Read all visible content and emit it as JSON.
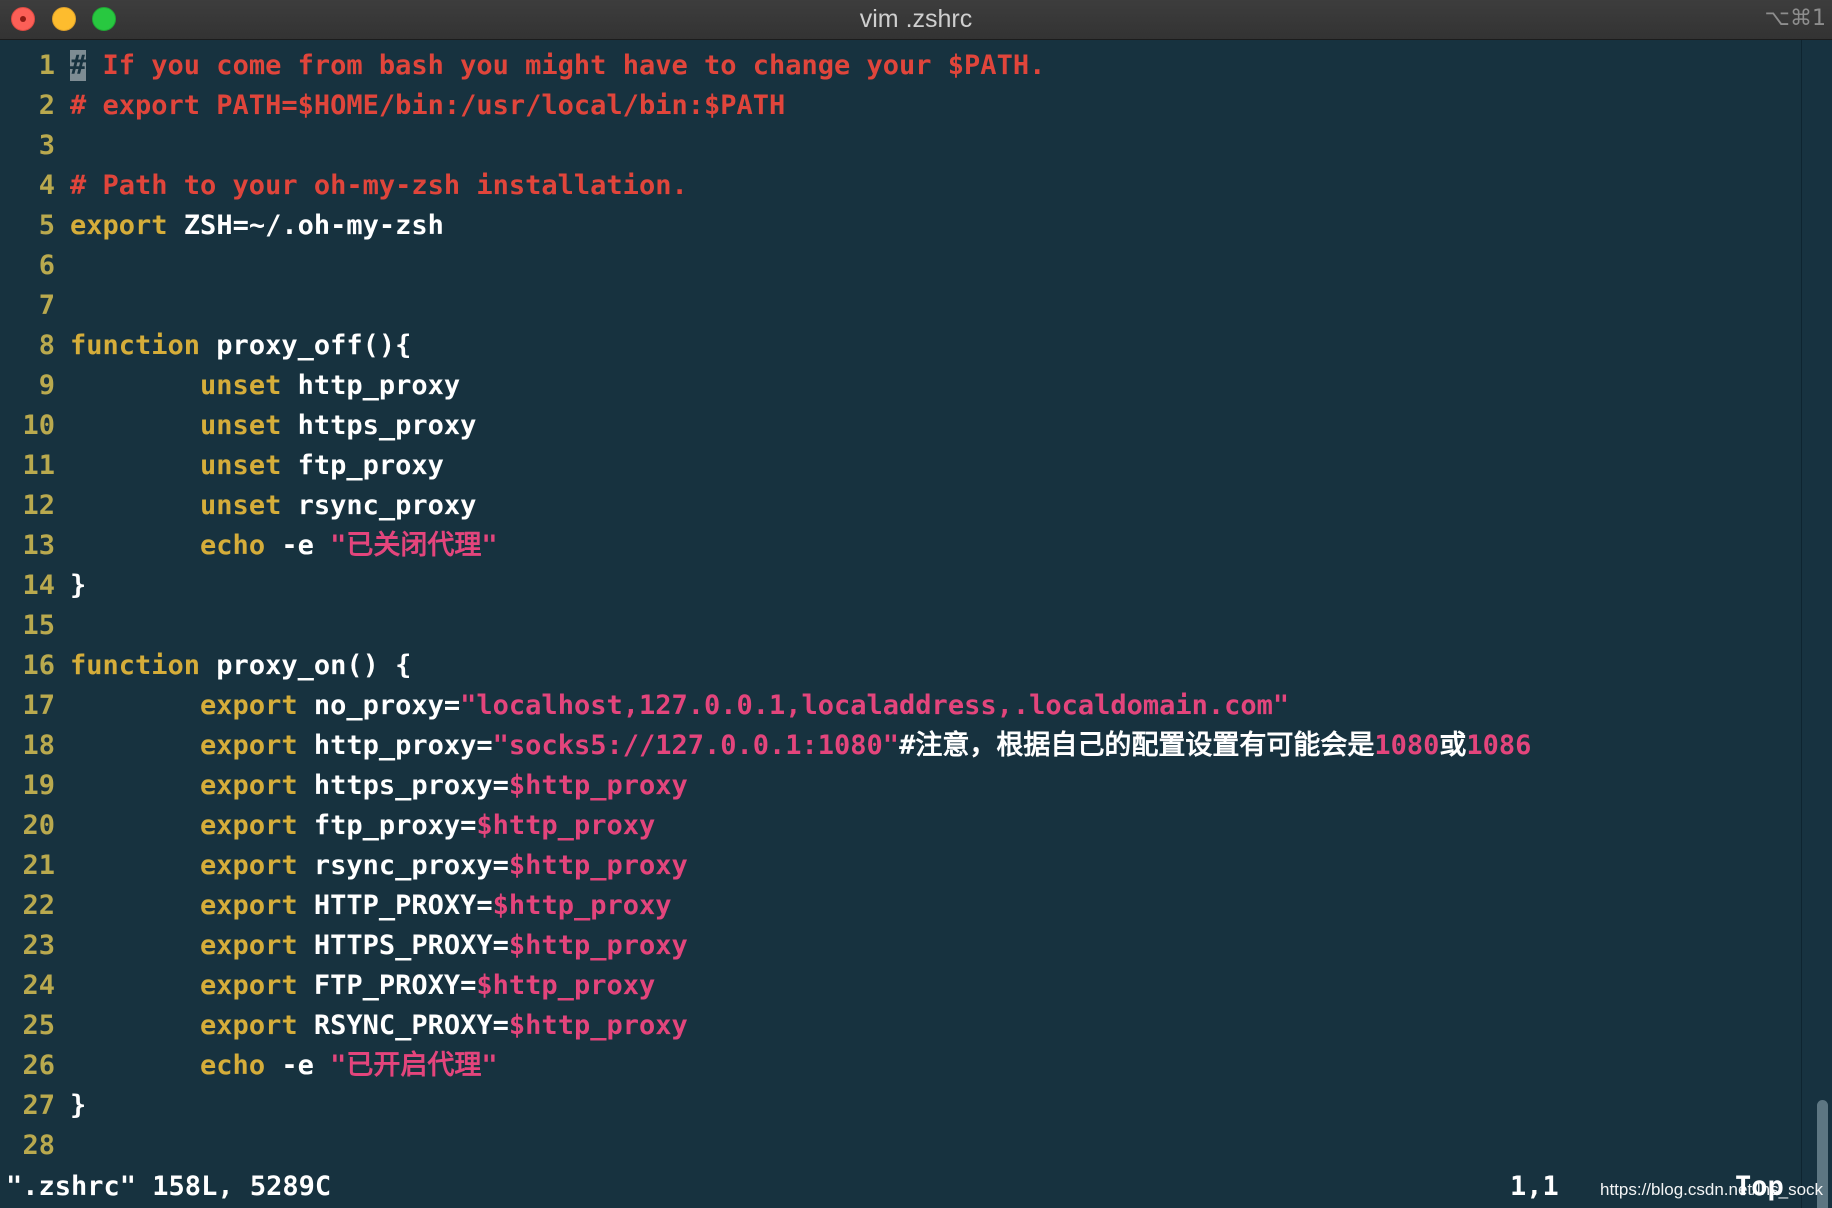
{
  "window": {
    "title": "vim .zshrc",
    "shortcut": "⌥⌘1"
  },
  "editor": {
    "lines": [
      {
        "n": "1",
        "tokens": [
          {
            "t": "#",
            "c": "cursor"
          },
          {
            "t": " If you come from bash you might have to change your $PATH.",
            "c": "cm"
          }
        ]
      },
      {
        "n": "2",
        "tokens": [
          {
            "t": "# export PATH=$HOME/bin:/usr/local/bin:$PATH",
            "c": "cm"
          }
        ]
      },
      {
        "n": "3",
        "tokens": []
      },
      {
        "n": "4",
        "tokens": [
          {
            "t": "# Path to your oh-my-zsh installation.",
            "c": "cm"
          }
        ]
      },
      {
        "n": "5",
        "tokens": [
          {
            "t": "export",
            "c": "kw"
          },
          {
            "t": " ZSH=~/.oh-my-zsh",
            "c": "id"
          }
        ]
      },
      {
        "n": "6",
        "tokens": []
      },
      {
        "n": "7",
        "tokens": []
      },
      {
        "n": "8",
        "tokens": [
          {
            "t": "function",
            "c": "kw"
          },
          {
            "t": " proxy_off(){",
            "c": "id"
          }
        ]
      },
      {
        "n": "9",
        "tokens": [
          {
            "t": "        ",
            "c": "id"
          },
          {
            "t": "unset",
            "c": "kw"
          },
          {
            "t": " http_proxy",
            "c": "id"
          }
        ]
      },
      {
        "n": "10",
        "tokens": [
          {
            "t": "        ",
            "c": "id"
          },
          {
            "t": "unset",
            "c": "kw"
          },
          {
            "t": " https_proxy",
            "c": "id"
          }
        ]
      },
      {
        "n": "11",
        "tokens": [
          {
            "t": "        ",
            "c": "id"
          },
          {
            "t": "unset",
            "c": "kw"
          },
          {
            "t": " ftp_proxy",
            "c": "id"
          }
        ]
      },
      {
        "n": "12",
        "tokens": [
          {
            "t": "        ",
            "c": "id"
          },
          {
            "t": "unset",
            "c": "kw"
          },
          {
            "t": " rsync_proxy",
            "c": "id"
          }
        ]
      },
      {
        "n": "13",
        "tokens": [
          {
            "t": "        ",
            "c": "id"
          },
          {
            "t": "echo",
            "c": "kw"
          },
          {
            "t": " -e ",
            "c": "id"
          },
          {
            "t": "\"已关闭代理\"",
            "c": "st"
          }
        ]
      },
      {
        "n": "14",
        "tokens": [
          {
            "t": "}",
            "c": "id"
          }
        ]
      },
      {
        "n": "15",
        "tokens": []
      },
      {
        "n": "16",
        "tokens": [
          {
            "t": "function",
            "c": "kw"
          },
          {
            "t": " proxy_on() {",
            "c": "id"
          }
        ]
      },
      {
        "n": "17",
        "tokens": [
          {
            "t": "        ",
            "c": "id"
          },
          {
            "t": "export",
            "c": "kw"
          },
          {
            "t": " no_proxy=",
            "c": "id"
          },
          {
            "t": "\"localhost,127.0.0.1,localaddress,.localdomain.com\"",
            "c": "st"
          }
        ]
      },
      {
        "n": "18",
        "tokens": [
          {
            "t": "        ",
            "c": "id"
          },
          {
            "t": "export",
            "c": "kw"
          },
          {
            "t": " http_proxy=",
            "c": "id"
          },
          {
            "t": "\"socks5://127.0.0.1:1080\"",
            "c": "st"
          },
          {
            "t": "#注意，根据自己的配置设置有可能会是",
            "c": "id"
          },
          {
            "t": "1080",
            "c": "st"
          },
          {
            "t": "或",
            "c": "id"
          },
          {
            "t": "1086",
            "c": "st"
          }
        ]
      },
      {
        "n": "19",
        "tokens": [
          {
            "t": "        ",
            "c": "id"
          },
          {
            "t": "export",
            "c": "kw"
          },
          {
            "t": " https_proxy=",
            "c": "id"
          },
          {
            "t": "$http_proxy",
            "c": "vr"
          }
        ]
      },
      {
        "n": "20",
        "tokens": [
          {
            "t": "        ",
            "c": "id"
          },
          {
            "t": "export",
            "c": "kw"
          },
          {
            "t": " ftp_proxy=",
            "c": "id"
          },
          {
            "t": "$http_proxy",
            "c": "vr"
          }
        ]
      },
      {
        "n": "21",
        "tokens": [
          {
            "t": "        ",
            "c": "id"
          },
          {
            "t": "export",
            "c": "kw"
          },
          {
            "t": " rsync_proxy=",
            "c": "id"
          },
          {
            "t": "$http_proxy",
            "c": "vr"
          }
        ]
      },
      {
        "n": "22",
        "tokens": [
          {
            "t": "        ",
            "c": "id"
          },
          {
            "t": "export",
            "c": "kw"
          },
          {
            "t": " HTTP_PROXY=",
            "c": "id"
          },
          {
            "t": "$http_proxy",
            "c": "vr"
          }
        ]
      },
      {
        "n": "23",
        "tokens": [
          {
            "t": "        ",
            "c": "id"
          },
          {
            "t": "export",
            "c": "kw"
          },
          {
            "t": " HTTPS_PROXY=",
            "c": "id"
          },
          {
            "t": "$http_proxy",
            "c": "vr"
          }
        ]
      },
      {
        "n": "24",
        "tokens": [
          {
            "t": "        ",
            "c": "id"
          },
          {
            "t": "export",
            "c": "kw"
          },
          {
            "t": " FTP_PROXY=",
            "c": "id"
          },
          {
            "t": "$http_proxy",
            "c": "vr"
          }
        ]
      },
      {
        "n": "25",
        "tokens": [
          {
            "t": "        ",
            "c": "id"
          },
          {
            "t": "export",
            "c": "kw"
          },
          {
            "t": " RSYNC_PROXY=",
            "c": "id"
          },
          {
            "t": "$http_proxy",
            "c": "vr"
          }
        ]
      },
      {
        "n": "26",
        "tokens": [
          {
            "t": "        ",
            "c": "id"
          },
          {
            "t": "echo",
            "c": "kw"
          },
          {
            "t": " -e ",
            "c": "id"
          },
          {
            "t": "\"已开启代理\"",
            "c": "st"
          }
        ]
      },
      {
        "n": "27",
        "tokens": [
          {
            "t": "}",
            "c": "id"
          }
        ]
      },
      {
        "n": "28",
        "tokens": []
      }
    ]
  },
  "status": {
    "file_info": "\".zshrc\" 158L, 5289C",
    "cursor_pos": "1,1",
    "scroll_pos": "Top"
  },
  "watermark": "https://blog.csdn.net/lhs_sock",
  "colors": {
    "background": "#17323f",
    "comment": "#e0453b",
    "keyword": "#d5ad3a",
    "string": "#e3457c",
    "line_number": "#b9a94e",
    "text": "#ffffff"
  }
}
